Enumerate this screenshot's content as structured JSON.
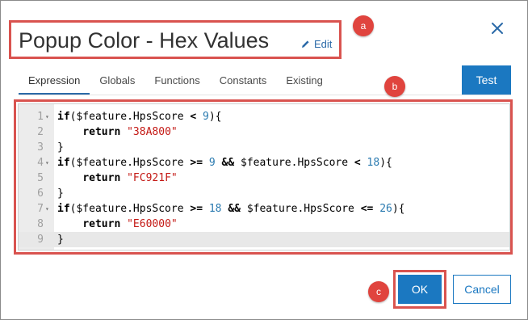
{
  "dialog": {
    "title": "Popup Color - Hex Values",
    "edit_label": "Edit",
    "close_icon": "close-icon",
    "accent_color": "#1b78c1",
    "annotation_color": "#e0443e"
  },
  "markers": {
    "a": "a",
    "b": "b",
    "c": "c"
  },
  "tabs": [
    {
      "label": "Expression",
      "active": true
    },
    {
      "label": "Globals",
      "active": false
    },
    {
      "label": "Functions",
      "active": false
    },
    {
      "label": "Constants",
      "active": false
    },
    {
      "label": "Existing",
      "active": false
    }
  ],
  "buttons": {
    "test": "Test",
    "ok": "OK",
    "cancel": "Cancel"
  },
  "editor": {
    "active_line": 9,
    "lines": [
      {
        "n": "1",
        "fold": true,
        "parts": [
          [
            "kw",
            "if"
          ],
          [
            "t",
            "($feature.HpsScore "
          ],
          [
            "op",
            "<"
          ],
          [
            "t",
            " "
          ],
          [
            "num",
            "9"
          ],
          [
            "t",
            "){"
          ]
        ]
      },
      {
        "n": "2",
        "fold": false,
        "parts": [
          [
            "t",
            "    "
          ],
          [
            "kw",
            "return"
          ],
          [
            "t",
            " "
          ],
          [
            "str",
            "\"38A800\""
          ]
        ]
      },
      {
        "n": "3",
        "fold": false,
        "parts": [
          [
            "t",
            "}"
          ]
        ]
      },
      {
        "n": "4",
        "fold": true,
        "parts": [
          [
            "kw",
            "if"
          ],
          [
            "t",
            "($feature.HpsScore "
          ],
          [
            "op",
            ">="
          ],
          [
            "t",
            " "
          ],
          [
            "num",
            "9"
          ],
          [
            "t",
            " "
          ],
          [
            "op",
            "&&"
          ],
          [
            "t",
            " $feature.HpsScore "
          ],
          [
            "op",
            "<"
          ],
          [
            "t",
            " "
          ],
          [
            "num",
            "18"
          ],
          [
            "t",
            "){"
          ]
        ]
      },
      {
        "n": "5",
        "fold": false,
        "parts": [
          [
            "t",
            "    "
          ],
          [
            "kw",
            "return"
          ],
          [
            "t",
            " "
          ],
          [
            "str",
            "\"FC921F\""
          ]
        ]
      },
      {
        "n": "6",
        "fold": false,
        "parts": [
          [
            "t",
            "}"
          ]
        ]
      },
      {
        "n": "7",
        "fold": true,
        "parts": [
          [
            "kw",
            "if"
          ],
          [
            "t",
            "($feature.HpsScore "
          ],
          [
            "op",
            ">="
          ],
          [
            "t",
            " "
          ],
          [
            "num",
            "18"
          ],
          [
            "t",
            " "
          ],
          [
            "op",
            "&&"
          ],
          [
            "t",
            " $feature.HpsScore "
          ],
          [
            "op",
            "<="
          ],
          [
            "t",
            " "
          ],
          [
            "num",
            "26"
          ],
          [
            "t",
            "){"
          ]
        ]
      },
      {
        "n": "8",
        "fold": false,
        "parts": [
          [
            "t",
            "    "
          ],
          [
            "kw",
            "return"
          ],
          [
            "t",
            " "
          ],
          [
            "str",
            "\"E60000\""
          ]
        ]
      },
      {
        "n": "9",
        "fold": false,
        "parts": [
          [
            "t",
            "}"
          ]
        ]
      }
    ]
  }
}
